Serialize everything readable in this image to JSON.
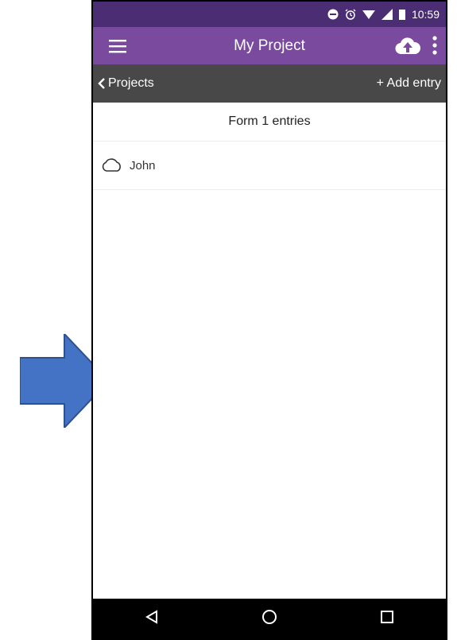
{
  "status_bar": {
    "time": "10:59"
  },
  "app_bar": {
    "title": "My Project"
  },
  "nav_bar": {
    "back_label": "Projects",
    "add_label": "+ Add entry"
  },
  "list": {
    "title": "Form 1 entries",
    "entries": [
      {
        "name": "John",
        "icon": "cloud-outline-icon"
      }
    ]
  },
  "colors": {
    "status_bar": "#4a2d72",
    "app_bar": "#7a4a9e",
    "nav_bar": "#484848",
    "arrow": "#4472c4"
  }
}
